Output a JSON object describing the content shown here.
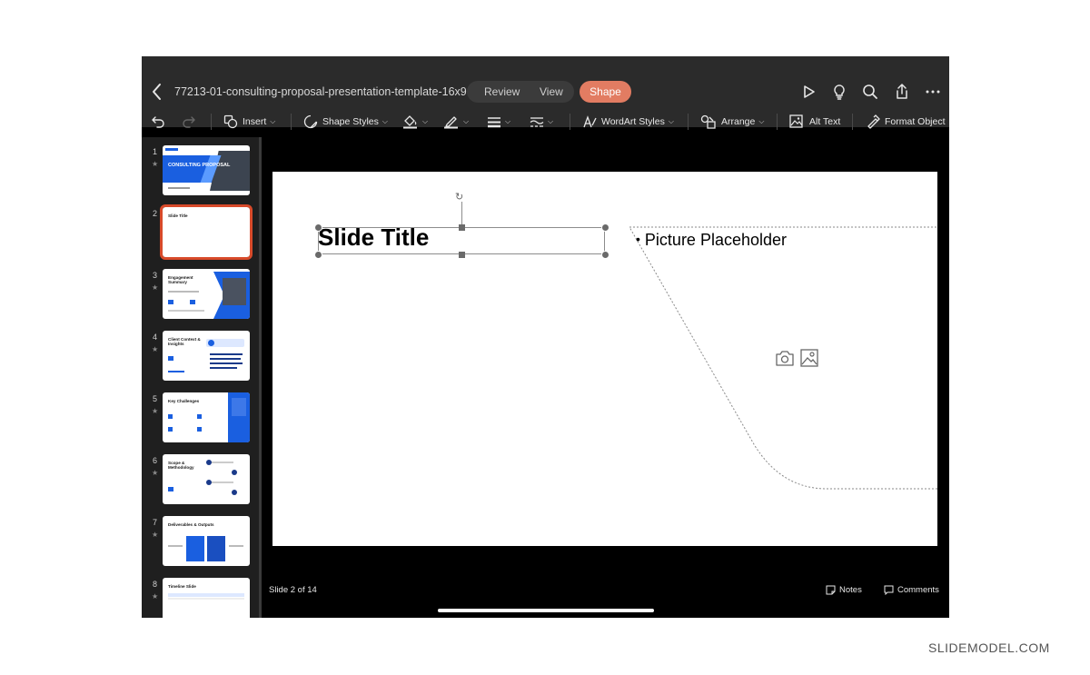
{
  "app": {
    "document_title": "77213-01-consulting-proposal-presentation-template-16x9",
    "tabs": [
      {
        "label": "Review"
      },
      {
        "label": "View"
      },
      {
        "label": "Shape",
        "active": true
      }
    ],
    "accent_color": "#e27c62",
    "header_icons": [
      "play-icon",
      "lightbulb-icon",
      "search-icon",
      "share-icon",
      "more-icon"
    ]
  },
  "ribbon": {
    "insert": "Insert",
    "shape_styles": "Shape Styles",
    "wordart_styles": "WordArt Styles",
    "arrange": "Arrange",
    "alt_text": "Alt Text",
    "format_object": "Format Object"
  },
  "slides": [
    {
      "number": "1",
      "label": "CONSULTING PROPOSAL"
    },
    {
      "number": "2",
      "label": "Slide Title",
      "selected": true
    },
    {
      "number": "3",
      "label": "Engagement Summary"
    },
    {
      "number": "4",
      "label": "Client Context & Insights"
    },
    {
      "number": "5",
      "label": "Key Challenges"
    },
    {
      "number": "6",
      "label": "Scope & Methodology"
    },
    {
      "number": "7",
      "label": "Deliverables & Outputs"
    },
    {
      "number": "8",
      "label": "Timeline Slide"
    }
  ],
  "canvas": {
    "slide_title": "Slide Title",
    "picture_placeholder": "Picture Placeholder"
  },
  "status": {
    "slide_indicator": "Slide 2 of 14",
    "notes": "Notes",
    "comments": "Comments"
  },
  "watermark": "SLIDEMODEL.COM"
}
